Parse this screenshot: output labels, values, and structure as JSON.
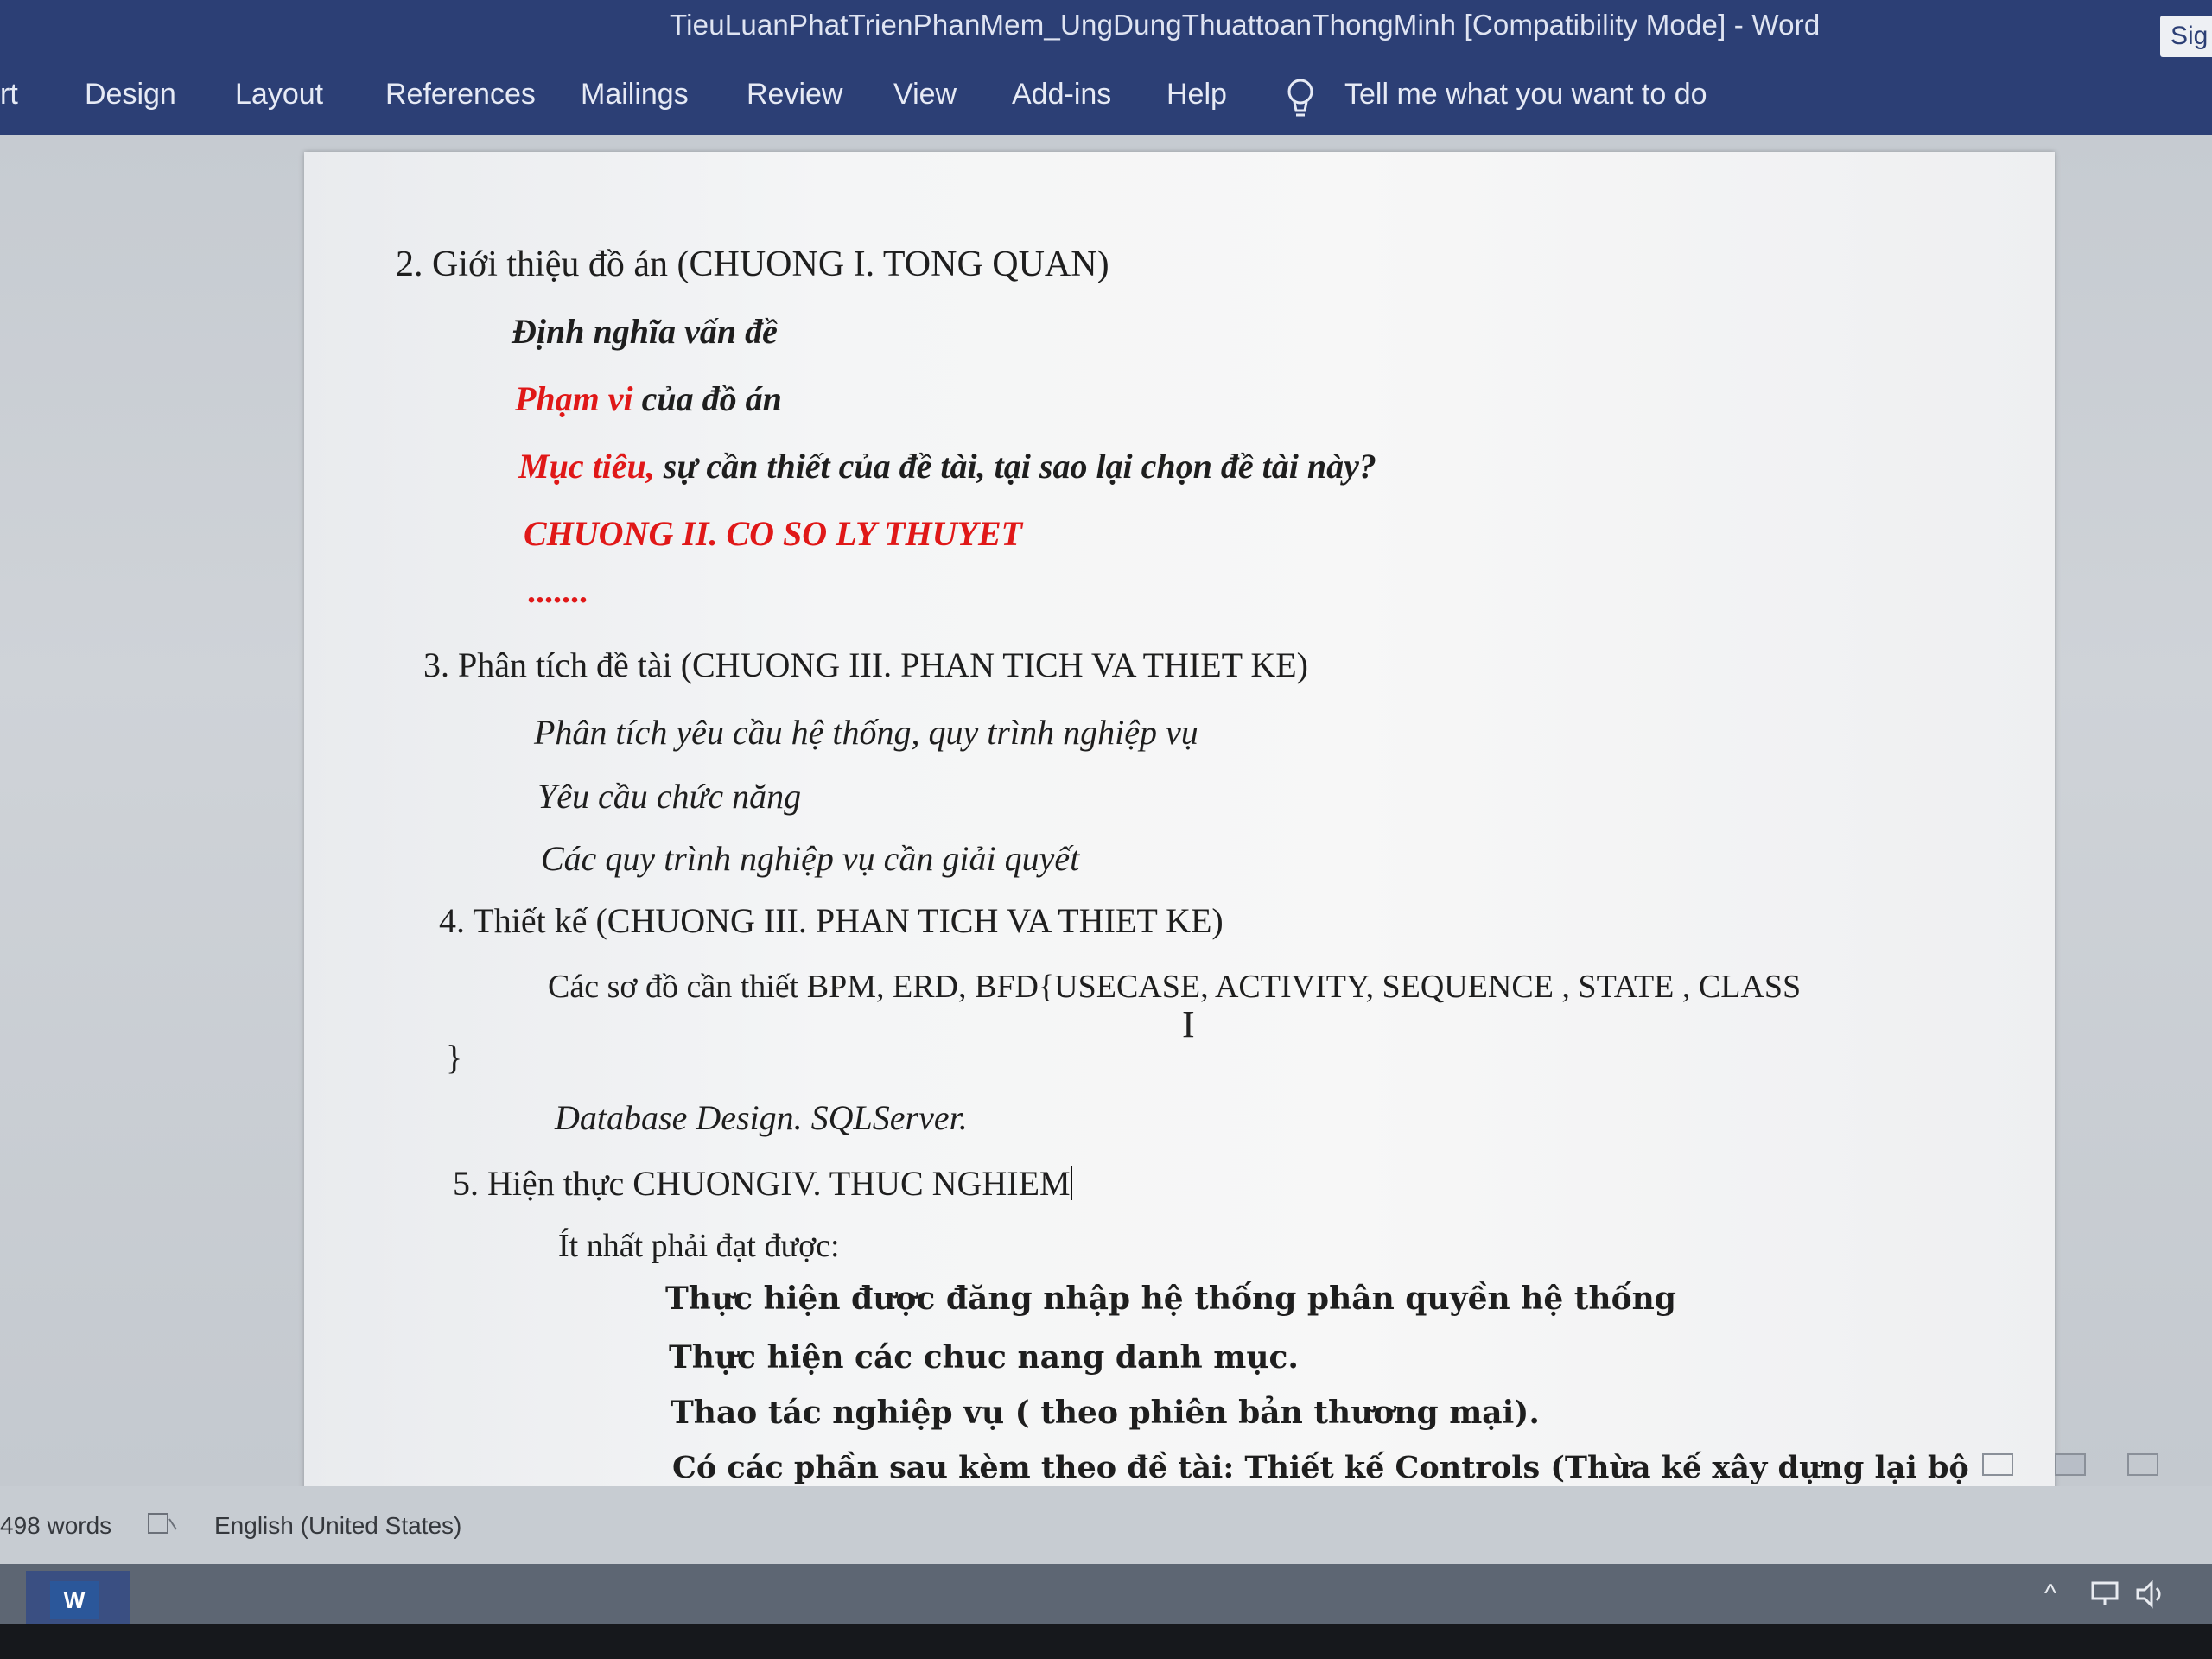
{
  "window": {
    "title": "TieuLuanPhatTrienPhanMem_UngDungThuattoanThongMinh [Compatibility Mode]  -  Word",
    "signin_label": "Sig"
  },
  "ribbon": {
    "tabs": [
      "rt",
      "Design",
      "Layout",
      "References",
      "Mailings",
      "Review",
      "View",
      "Add-ins",
      "Help"
    ],
    "tell_me": "Tell me what you want to do"
  },
  "document": {
    "lines": {
      "s2_heading": "2. Giới thiệu đồ án   (CHUONG I. TONG QUAN)",
      "dinh_nghia": "Định nghĩa vấn đề",
      "pham_vi_red": "Phạm vi",
      "pham_vi_rest": " của đồ án",
      "muc_tieu_red": "Mục tiêu,",
      "muc_tieu_rest": " sự cần thiết của đề tài, tại sao lại chọn đề tài này?",
      "chuong2": "CHUONG II. CO SO LY THUYET",
      "dots": ".......",
      "s3_heading": "3. Phân tích đề tài (CHUONG III. PHAN TICH VA THIET KE)",
      "phan_tich_yc": "Phân tích yêu cầu hệ thống, quy trình nghiệp vụ",
      "yc_chuc_nang": "Yêu cầu chức năng",
      "quy_trinh": "Các quy trình nghiệp vụ cần giải quyết",
      "s4_heading": "4. Thiết kế (CHUONG III. PHAN TICH VA THIET KE)",
      "so_do": "Các sơ đồ cần thiết BPM, ERD, BFD{USECASE, ACTIVITY, SEQUENCE , STATE , CLASS",
      "closing_brace": "}",
      "database": "Database Design. SQLServer.",
      "s5_heading": "5. Hiện thực CHUONGIV. THUC NGHIEM",
      "it_nhat": "Ít nhất phải đạt được:",
      "dang_nhap": "Thực hiện được đăng nhập hệ thống phân quyền hệ thống",
      "danh_muc": "Thực hiện các chuc nang danh mục.",
      "thao_tac": "Thao tác nghiệp vụ ( theo phiên bản thương mại).",
      "co_cac_phan": "Có  các  phần  sau  kèm  theo  đề  tài:  Thiết  kế  Controls  (Thừa  kế  xây  dựng  lại  bộ"
    }
  },
  "status": {
    "word_count": "498 words",
    "language": "English (United States)"
  },
  "taskbar": {
    "word_app_label": "W"
  },
  "colors": {
    "ribbon_bg": "#2c3f75",
    "accent_red": "#e01818"
  }
}
